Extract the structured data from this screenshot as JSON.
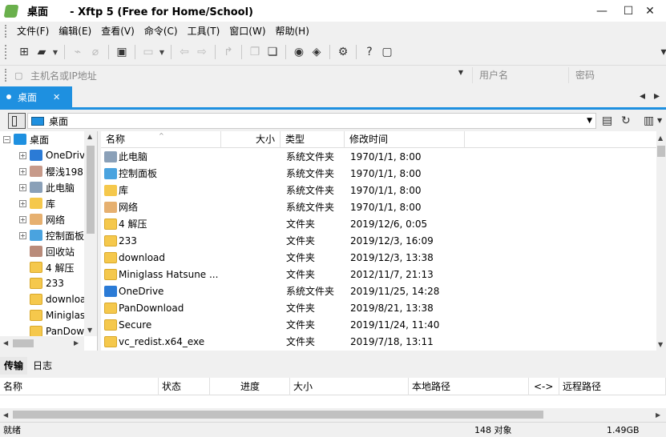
{
  "window": {
    "title": "桌面      - Xftp 5 (Free for Home/School)",
    "controls": [
      "—",
      "☐",
      "✕"
    ]
  },
  "menu": [
    "文件(F)",
    "编辑(E)",
    "查看(V)",
    "命令(C)",
    "工具(T)",
    "窗口(W)",
    "帮助(H)"
  ],
  "address": {
    "host_placeholder": "主机名或IP地址",
    "user_placeholder": "用户名",
    "password_placeholder": "密码"
  },
  "tabs": [
    {
      "label": "桌面",
      "close": "✕"
    }
  ],
  "path": {
    "current": "桌面"
  },
  "tree": [
    {
      "label": "桌面",
      "icon": "desktop-icon",
      "expander": "−"
    },
    {
      "label": "OneDrive",
      "icon": "cloud-icon",
      "expander": "+"
    },
    {
      "label": "樱浅198",
      "icon": "user-icon",
      "expander": "+"
    },
    {
      "label": "此电脑",
      "icon": "computer-icon",
      "expander": "+"
    },
    {
      "label": "库",
      "icon": "library-icon",
      "expander": "+"
    },
    {
      "label": "网络",
      "icon": "network-icon",
      "expander": "+"
    },
    {
      "label": "控制面板",
      "icon": "control-panel-icon",
      "expander": "+"
    },
    {
      "label": "回收站",
      "icon": "recycle-bin-icon",
      "expander": ""
    },
    {
      "label": "4  解压",
      "icon": "folder-icon",
      "expander": ""
    },
    {
      "label": "233",
      "icon": "folder-icon",
      "expander": ""
    },
    {
      "label": "download",
      "icon": "folder-icon",
      "expander": ""
    },
    {
      "label": "Miniglass",
      "icon": "folder-icon",
      "expander": ""
    },
    {
      "label": "PanDownload",
      "icon": "folder-icon",
      "expander": ""
    }
  ],
  "file_list": {
    "columns": [
      "名称",
      "大小",
      "类型",
      "修改时间"
    ],
    "rows": [
      {
        "name": "此电脑",
        "size": "",
        "type": "系统文件夹",
        "modified": "1970/1/1, 8:00",
        "icon": "computer-icon"
      },
      {
        "name": "控制面板",
        "size": "",
        "type": "系统文件夹",
        "modified": "1970/1/1, 8:00",
        "icon": "control-panel-icon"
      },
      {
        "name": "库",
        "size": "",
        "type": "系统文件夹",
        "modified": "1970/1/1, 8:00",
        "icon": "library-icon"
      },
      {
        "name": "网络",
        "size": "",
        "type": "系统文件夹",
        "modified": "1970/1/1, 8:00",
        "icon": "network-icon"
      },
      {
        "name": "4  解压",
        "size": "",
        "type": "文件夹",
        "modified": "2019/12/6, 0:05",
        "icon": "folder-icon"
      },
      {
        "name": "233",
        "size": "",
        "type": "文件夹",
        "modified": "2019/12/3, 16:09",
        "icon": "folder-icon"
      },
      {
        "name": "download",
        "size": "",
        "type": "文件夹",
        "modified": "2019/12/3, 13:38",
        "icon": "folder-icon"
      },
      {
        "name": "Miniglass Hatsune ...",
        "size": "",
        "type": "文件夹",
        "modified": "2012/11/7, 21:13",
        "icon": "folder-icon"
      },
      {
        "name": "OneDrive",
        "size": "",
        "type": "系统文件夹",
        "modified": "2019/11/25, 14:28",
        "icon": "cloud-icon"
      },
      {
        "name": "PanDownload",
        "size": "",
        "type": "文件夹",
        "modified": "2019/8/21, 13:38",
        "icon": "folder-icon"
      },
      {
        "name": "Secure",
        "size": "",
        "type": "文件夹",
        "modified": "2019/11/24, 11:40",
        "icon": "folder-icon"
      },
      {
        "name": "vc_redist.x64_exe",
        "size": "",
        "type": "文件夹",
        "modified": "2019/7/18, 13:11",
        "icon": "folder-icon"
      }
    ]
  },
  "transfer": {
    "tabs": [
      "传输",
      "日志"
    ],
    "columns": [
      "名称",
      "状态",
      "进度",
      "大小",
      "本地路径",
      "<->",
      "远程路径"
    ]
  },
  "status": {
    "text": "就绪",
    "count": "148 对象",
    "size": "1.49GB"
  },
  "colors": {
    "accent": "#1e90e0",
    "folder": "#f5c84c"
  }
}
